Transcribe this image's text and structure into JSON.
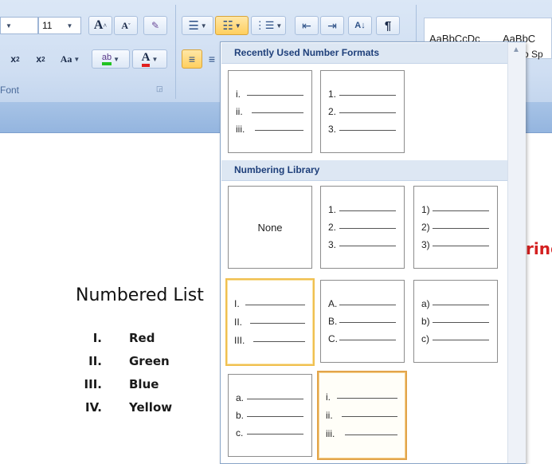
{
  "ribbon": {
    "font_size": "11",
    "grow_font": "A",
    "shrink_font": "A",
    "change_case": "Aa",
    "font_color_letter": "A",
    "highlight_letter": "ab",
    "group_font_label": "Font",
    "style_samples": [
      "AaBbCcDc",
      "AaBbC"
    ],
    "style_name_partial": "o Sp"
  },
  "dropdown": {
    "recent_header": "Recently Used Number Formats",
    "library_header": "Numbering Library",
    "none_label": "None",
    "recent_tiles": [
      [
        "i.",
        "ii.",
        "iii."
      ],
      [
        "1.",
        "2.",
        "3."
      ]
    ],
    "library_tiles": [
      [
        "1.",
        "2.",
        "3."
      ],
      [
        "1)",
        "2)",
        "3)"
      ],
      [
        "I.",
        "II.",
        "III."
      ],
      [
        "A.",
        "B.",
        "C."
      ],
      [
        "a)",
        "b)",
        "c)"
      ],
      [
        "a.",
        "b.",
        "c."
      ],
      [
        "i.",
        "ii.",
        "iii."
      ]
    ]
  },
  "document": {
    "title": "Numbered List",
    "partial_red_text": "ring",
    "items": [
      {
        "num": "I.",
        "text": "Red"
      },
      {
        "num": "II.",
        "text": "Green"
      },
      {
        "num": "III.",
        "text": "Blue"
      },
      {
        "num": "IV.",
        "text": "Yellow"
      }
    ]
  },
  "colors": {
    "accent_highlight": "#f0c050",
    "header_text": "#1e3f7a",
    "highlight_green": "#22c322",
    "font_red": "#e02020"
  }
}
